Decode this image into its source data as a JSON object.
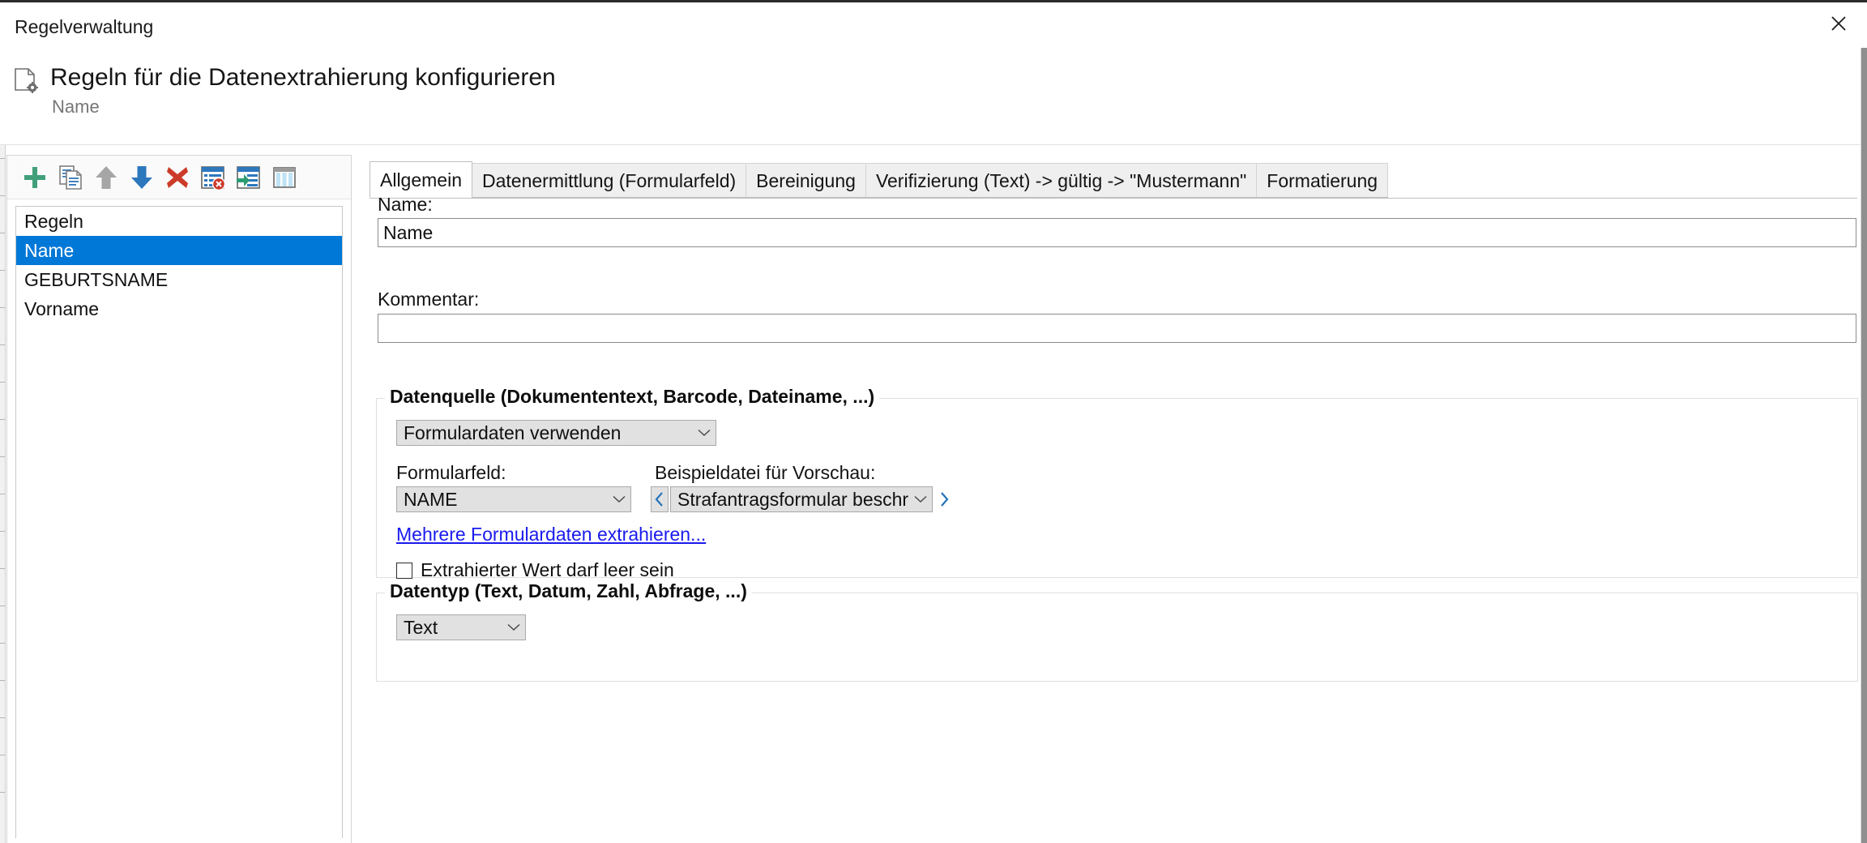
{
  "window": {
    "title": "Regelverwaltung",
    "close_icon": "close-icon"
  },
  "header": {
    "icon": "document-settings-icon",
    "title": "Regeln für die Datenextrahierung konfigurieren",
    "subtitle": "Name"
  },
  "toolbar": {
    "buttons": [
      {
        "name": "add-rule-button",
        "icon": "plus-icon",
        "label": "Hinzufügen"
      },
      {
        "name": "copy-rule-button",
        "icon": "copy-icon",
        "label": "Kopieren"
      },
      {
        "name": "move-up-button",
        "icon": "arrow-up-icon",
        "label": "Nach oben"
      },
      {
        "name": "move-down-button",
        "icon": "arrow-down-icon",
        "label": "Nach unten"
      },
      {
        "name": "delete-rule-button",
        "icon": "delete-x-icon",
        "label": "Löschen"
      },
      {
        "name": "clear-list-button",
        "icon": "list-delete-icon",
        "label": "Liste löschen"
      },
      {
        "name": "import-button",
        "icon": "list-import-icon",
        "label": "Importieren"
      },
      {
        "name": "columns-button",
        "icon": "columns-icon",
        "label": "Spalten"
      }
    ]
  },
  "rules_list": {
    "header": "Regeln",
    "items": [
      {
        "label": "Name",
        "selected": true
      },
      {
        "label": "GEBURTSNAME",
        "selected": false
      },
      {
        "label": "Vorname",
        "selected": false
      }
    ]
  },
  "tabs": [
    {
      "label": "Allgemein",
      "active": true
    },
    {
      "label": "Datenermittlung (Formularfeld)",
      "active": false
    },
    {
      "label": "Bereinigung",
      "active": false
    },
    {
      "label": "Verifizierung (Text) -> gültig -> \"Mustermann\"",
      "active": false
    },
    {
      "label": "Formatierung",
      "active": false
    }
  ],
  "form": {
    "name_label": "Name:",
    "name_value": "Name",
    "kommentar_label": "Kommentar:",
    "kommentar_value": ""
  },
  "datenquelle": {
    "group_title": "Datenquelle (Dokumententext, Barcode, Dateiname, ...)",
    "source_value": "Formulardaten verwenden",
    "formularfeld_label": "Formularfeld:",
    "formularfeld_value": "NAME",
    "beispieldatei_label": "Beispieldatei für Vorschau:",
    "beispieldatei_value": "Strafantragsformular beschreibbar.pdf",
    "prev_icon": "chevron-left-icon",
    "next_icon": "chevron-right-icon",
    "link_label": "Mehrere Formulardaten extrahieren...",
    "checkbox_label": "Extrahierter Wert darf leer sein",
    "checkbox_checked": false
  },
  "datentyp": {
    "group_title": "Datentyp (Text, Datum, Zahl, Abfrage, ...)",
    "value": "Text"
  },
  "colors": {
    "selection": "#0078d7",
    "link": "#1a1aee",
    "accent_green": "#3a9b72",
    "accent_red": "#cf3c29",
    "accent_blue": "#2573b8"
  }
}
